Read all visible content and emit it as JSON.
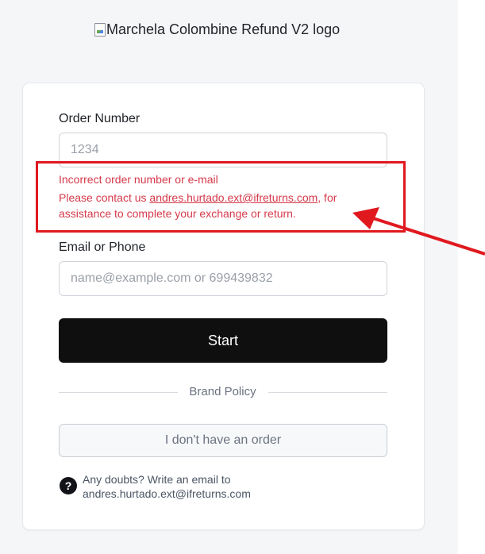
{
  "logo": {
    "alt_text": "Marchela Colombine Refund V2 logo"
  },
  "form": {
    "order_label": "Order Number",
    "order_placeholder": "1234",
    "error_title": "Incorrect order number or e-mail",
    "error_prefix": "Please contact us ",
    "error_email": "andres.hurtado.ext@ifreturns.com",
    "error_suffix": ", for assistance to complete your exchange or return.",
    "email_label": "Email or Phone",
    "email_placeholder": "name@example.com or 699439832",
    "start_label": "Start",
    "divider_label": "Brand Policy",
    "no_order_label": "I don't have an order"
  },
  "help": {
    "line1": "Any doubts? Write an email to",
    "line2": "andres.hurtado.ext@ifreturns.com"
  },
  "annotation": {
    "color": "#e0191f"
  },
  "colors": {
    "error": "#d6394a",
    "primary_button": "#0f0f10",
    "page_background": "#f5f6f8"
  }
}
